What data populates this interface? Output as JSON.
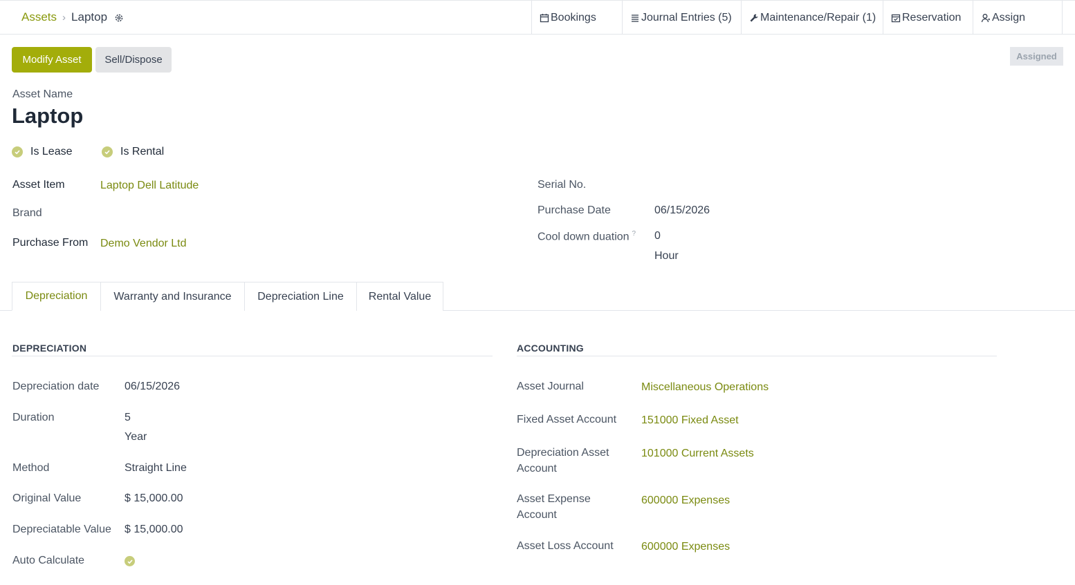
{
  "breadcrumb": {
    "parent": "Assets",
    "current": "Laptop"
  },
  "smart_buttons": [
    {
      "label": "Bookings",
      "icon": "calendar-icon"
    },
    {
      "label": "Journal Entries (5)",
      "icon": "list-icon"
    },
    {
      "label": "Maintenance/Repair (1)",
      "icon": "wrench-icon"
    },
    {
      "label": "Reservation",
      "icon": "calendar-check-icon"
    },
    {
      "label": "Assign",
      "icon": "user-icon"
    }
  ],
  "actions": {
    "modify": "Modify Asset",
    "sell": "Sell/Dispose"
  },
  "status": "Assigned",
  "asset_name_label": "Asset Name",
  "asset_name": "Laptop",
  "checks": {
    "is_lease": "Is Lease",
    "is_rental": "Is Rental"
  },
  "fields_left": {
    "asset_item_label": "Asset Item",
    "asset_item": "Laptop Dell Latitude",
    "brand_label": "Brand",
    "purchase_from_label": "Purchase From",
    "purchase_from": "Demo Vendor Ltd"
  },
  "fields_right": {
    "serial_label": "Serial No.",
    "purchase_date_label": "Purchase Date",
    "purchase_date": "06/15/2026",
    "cooldown_label": "Cool down duation",
    "cooldown_help": "?",
    "cooldown_value": "0",
    "cooldown_unit": "Hour"
  },
  "tabs": [
    "Depreciation",
    "Warranty and Insurance",
    "Depreciation Line",
    "Rental Value"
  ],
  "depreciation": {
    "title": "DEPRECIATION",
    "date_label": "Depreciation date",
    "date": "06/15/2026",
    "duration_label": "Duration",
    "duration": "5",
    "duration_unit": "Year",
    "method_label": "Method",
    "method": "Straight Line",
    "original_label": "Original Value",
    "original": "$ 15,000.00",
    "depreciable_label": "Depreciatable Value",
    "depreciable": "$ 15,000.00",
    "auto_label": "Auto Calculate"
  },
  "accounting": {
    "title": "ACCOUNTING",
    "journal_label": "Asset Journal",
    "journal": "Miscellaneous Operations",
    "fixed_label": "Fixed Asset Account",
    "fixed": "151000 Fixed Asset",
    "dep_label_1": "Depreciation Asset",
    "dep_label_2": "Account",
    "dep": "101000 Current Assets",
    "expense_label_1": "Asset Expense",
    "expense_label_2": "Account",
    "expense": "600000 Expenses",
    "loss_label": "Asset Loss Account",
    "loss": "600000 Expenses"
  },
  "colors": {
    "accent": "#a3ad0a",
    "link": "#7a8a10",
    "check": "#c7cd7b"
  }
}
